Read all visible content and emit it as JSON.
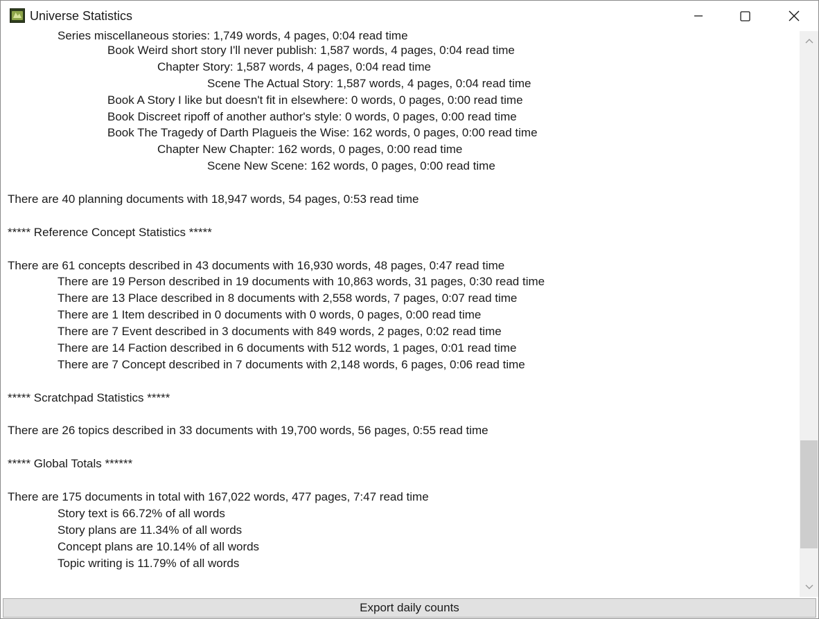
{
  "window": {
    "title": "Universe Statistics",
    "icon": "app-landscape-icon"
  },
  "content": {
    "partial_top_line": "Series miscellaneous stories: 1,749 words, 4 pages, 0:04 read time",
    "lines": [
      {
        "indent": 2,
        "text": "Book Weird short story I'll never publish: 1,587 words, 4 pages, 0:04 read time"
      },
      {
        "indent": 3,
        "text": "Chapter Story: 1,587 words, 4 pages, 0:04 read time"
      },
      {
        "indent": 4,
        "text": "Scene The Actual Story: 1,587 words, 4 pages, 0:04 read time"
      },
      {
        "indent": 2,
        "text": "Book A Story I like but doesn't fit in elsewhere: 0 words, 0 pages, 0:00 read time"
      },
      {
        "indent": 2,
        "text": "Book Discreet ripoff of another author's style: 0 words, 0 pages, 0:00 read time"
      },
      {
        "indent": 2,
        "text": "Book The Tragedy of Darth Plagueis the Wise: 162 words, 0 pages, 0:00 read time"
      },
      {
        "indent": 3,
        "text": "Chapter New Chapter: 162 words, 0 pages, 0:00 read time"
      },
      {
        "indent": 4,
        "text": "Scene New Scene: 162 words, 0 pages, 0:00 read time"
      },
      {
        "indent": 0,
        "text": ""
      },
      {
        "indent": 0,
        "text": "There are 40 planning documents with 18,947 words, 54 pages, 0:53 read time"
      },
      {
        "indent": 0,
        "text": ""
      },
      {
        "indent": 0,
        "text": "***** Reference Concept Statistics *****"
      },
      {
        "indent": 0,
        "text": ""
      },
      {
        "indent": 0,
        "text": "There are 61 concepts described in 43 documents with 16,930 words, 48 pages, 0:47 read time"
      },
      {
        "indent": 1,
        "text": "There are 19 Person described in 19 documents with 10,863 words, 31 pages, 0:30 read time"
      },
      {
        "indent": 1,
        "text": "There are 13 Place described in 8 documents with 2,558 words, 7 pages, 0:07 read time"
      },
      {
        "indent": 1,
        "text": "There are 1 Item described in 0 documents with 0 words, 0 pages, 0:00 read time"
      },
      {
        "indent": 1,
        "text": "There are 7 Event described in 3 documents with 849 words, 2 pages, 0:02 read time"
      },
      {
        "indent": 1,
        "text": "There are 14 Faction described in 6 documents with 512 words, 1 pages, 0:01 read time"
      },
      {
        "indent": 1,
        "text": "There are 7 Concept described in 7 documents with 2,148 words, 6 pages, 0:06 read time"
      },
      {
        "indent": 0,
        "text": ""
      },
      {
        "indent": 0,
        "text": "***** Scratchpad Statistics *****"
      },
      {
        "indent": 0,
        "text": ""
      },
      {
        "indent": 0,
        "text": "There are 26 topics described in 33 documents with 19,700 words, 56 pages, 0:55 read time"
      },
      {
        "indent": 0,
        "text": ""
      },
      {
        "indent": 0,
        "text": "***** Global Totals ******"
      },
      {
        "indent": 0,
        "text": ""
      },
      {
        "indent": 0,
        "text": "There are 175 documents in total with 167,022 words, 477 pages, 7:47 read time"
      },
      {
        "indent": 1,
        "text": "Story text is 66.72% of all words"
      },
      {
        "indent": 1,
        "text": "Story plans are 11.34% of all words"
      },
      {
        "indent": 1,
        "text": "Concept plans are 10.14% of all words"
      },
      {
        "indent": 1,
        "text": "Topic writing is 11.79% of all words"
      }
    ]
  },
  "scrollbar": {
    "position_fraction": 0.93
  },
  "footer": {
    "export_button_label": "Export daily counts"
  },
  "colors": {
    "text": "#1a1a1a",
    "button_bg": "#e1e1e1",
    "scrollbar_track": "#f0f0f0",
    "scrollbar_thumb": "#cdcdcd"
  }
}
